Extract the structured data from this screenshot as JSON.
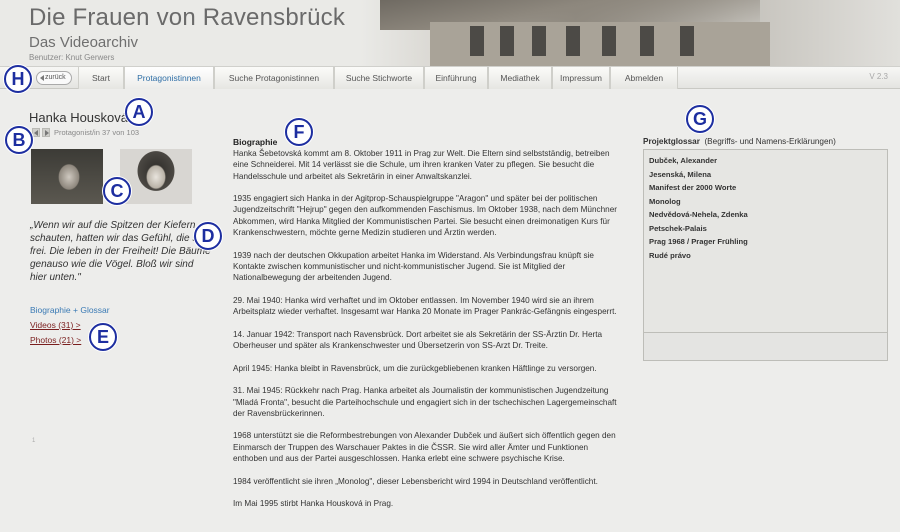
{
  "header": {
    "title": "Die Frauen von Ravensbrück",
    "subtitle": "Das Videoarchiv",
    "user": "Benutzer: Knut Gerwers"
  },
  "nav": {
    "back_label": "zurück",
    "items": [
      {
        "label": "Start"
      },
      {
        "label": "Protagonistinnen"
      },
      {
        "label": "Suche Protagonistinnen"
      },
      {
        "label": "Suche Stichworte"
      },
      {
        "label": "Einführung"
      },
      {
        "label": "Mediathek"
      },
      {
        "label": "Impressum"
      },
      {
        "label": "Abmelden"
      }
    ],
    "active_index": 1,
    "version": "V 2.3"
  },
  "markers": {
    "a": "A",
    "b": "B",
    "c": "C",
    "d": "D",
    "e": "E",
    "f": "F",
    "g": "G",
    "h": "H"
  },
  "person": {
    "name": "Hanka Housková",
    "pager_text": "Protagonist/in 37 von 103",
    "quote": "„Wenn wir auf die Spitzen der Kiefern schauten, hatten wir das Gefühl, die sind frei. Die leben in der Freiheit! Die Bäume genauso wie die Vögel. Bloß wir sind hier unten.\"",
    "link_bio": "Biographie + Glossar",
    "link_videos": "Videos (31) >",
    "link_photos": "Photos (21) >",
    "tiny_mark": "1"
  },
  "biography": {
    "heading": "Biographie",
    "paragraphs": [
      "Hanka Šebetovská kommt am 8. Oktober 1911 in Prag zur Welt. Die Eltern sind selbstständig, betreiben eine Schneiderei. Mit 14 verlässt sie die Schule, um ihren kranken Vater zu pflegen. Sie besucht die Handelsschule und arbeitet als Sekretärin in einer Anwaltskanzlei.",
      "1935 engagiert sich Hanka in der Agitprop-Schauspielgruppe \"Aragon\" und später bei der politischen Jugendzeitschrift \"Hejrup\" gegen den aufkommenden Faschismus. Im Oktober 1938, nach dem Münchner Abkommen, wird Hanka Mitglied der Kommunistischen Partei. Sie besucht einen dreimonatigen Kurs für Krankenschwestern, möchte gerne Medizin studieren und Ärztin werden.",
      "1939 nach der deutschen Okkupation arbeitet Hanka im Widerstand. Als Verbindungsfrau knüpft sie Kontakte zwischen kommunistischer und nicht-kommunistischer Jugend. Sie ist Mitglied der Nationalbewegung der arbeitenden Jugend.",
      "29. Mai 1940: Hanka wird verhaftet und im Oktober entlassen. Im November 1940 wird sie an ihrem Arbeitsplatz wieder verhaftet. Insgesamt war Hanka 20 Monate im Prager Pankrác-Gefängnis eingesperrt.",
      "14. Januar 1942: Transport nach Ravensbrück. Dort arbeitet sie als Sekretärin der SS-Ärztin Dr. Herta Oberheuser und später als Krankenschwester und Übersetzerin von SS-Arzt Dr. Treite.",
      "April 1945: Hanka bleibt in Ravensbrück, um die zurückgebliebenen kranken Häftlinge zu versorgen.",
      "31. Mai 1945: Rückkehr nach Prag. Hanka arbeitet als Journalistin der kommunistischen Jugendzeitung \"Mladá Fronta\", besucht die Parteihochschule und engagiert sich in der tschechischen Lagergemeinschaft der Ravensbrückerinnen.",
      "1968 unterstützt sie die Reformbestrebungen von Alexander Dubček und äußert sich öffentlich gegen den Einmarsch der Truppen des Warschauer Paktes in die ČSSR. Sie wird aller Ämter und Funktionen enthoben und aus der Partei ausgeschlossen. Hanka erlebt eine schwere psychische Krise.",
      "1984 veröffentlicht sie ihren „Monolog\", dieser Lebensbericht wird 1994 in Deutschland veröffentlicht.",
      "Im Mai 1995 stirbt Hanka Housková in Prag."
    ]
  },
  "glossary": {
    "title": "Projektglossar",
    "subtitle": "(Begriffs- und Namens-Erklärungen)",
    "items": [
      "Dubček, Alexander",
      "Jesenská, Milena",
      "Manifest der 2000 Worte",
      "Monolog",
      "Nedvědová-Nehela, Zdenka",
      "Petschek-Palais",
      "Prag 1968 / Prager Frühling",
      "Rudé právo"
    ]
  }
}
